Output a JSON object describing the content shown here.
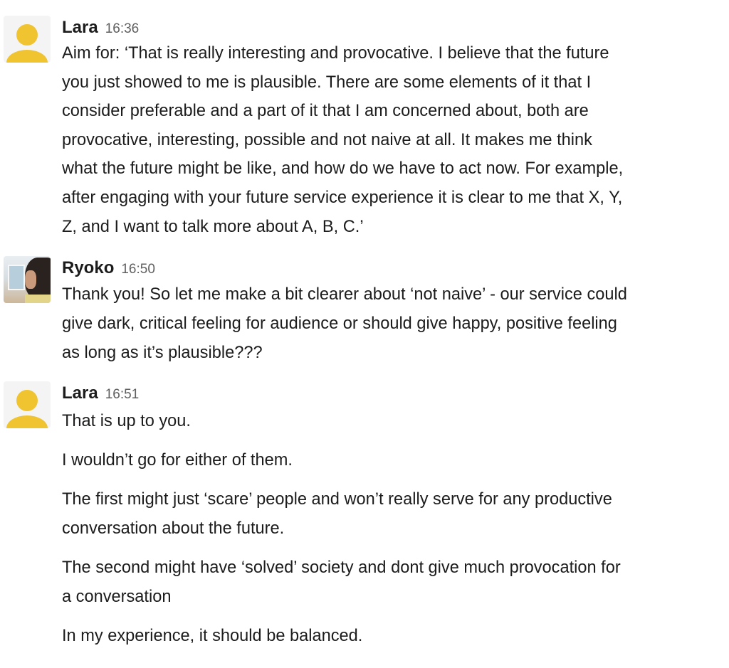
{
  "messages": [
    {
      "author": "Lara",
      "time": "16:36",
      "avatar_icon": "default-person-icon",
      "lines": [
        "Aim for: ‘That is really interesting and provocative. I believe that the future",
        "you just showed to me is plausible. There are some elements of it that I",
        "consider preferable and a part of it that I am concerned about, both are",
        "provocative, interesting, possible and not naive at all. It makes me think",
        "what the future might be like, and how do we have to act now. For example,",
        "after engaging with your future service experience it is clear to me that X, Y,",
        "Z, and I want to talk more about A, B, C.’"
      ]
    },
    {
      "author": "Ryoko",
      "time": "16:50",
      "avatar_icon": "user-photo",
      "lines": [
        "Thank you! So let me make a bit clearer about ‘not naive’ - our service could",
        "give dark, critical feeling for audience or should give happy, positive feeling",
        "as long as it’s plausible???"
      ]
    },
    {
      "author": "Lara",
      "time": "16:51",
      "avatar_icon": "default-person-icon",
      "lines": [
        "That is up to you.",
        "I wouldn’t go for either of them.",
        "The first might just ‘scare’ people and won’t really serve for any productive",
        "conversation about the future.",
        "The second might have ‘solved’ society and dont give much provocation for",
        "a conversation",
        "In my experience, it should be balanced."
      ]
    }
  ],
  "colors": {
    "avatar_default": "#f0c330",
    "text": "#1d1c1d",
    "timestamp": "#616061"
  }
}
